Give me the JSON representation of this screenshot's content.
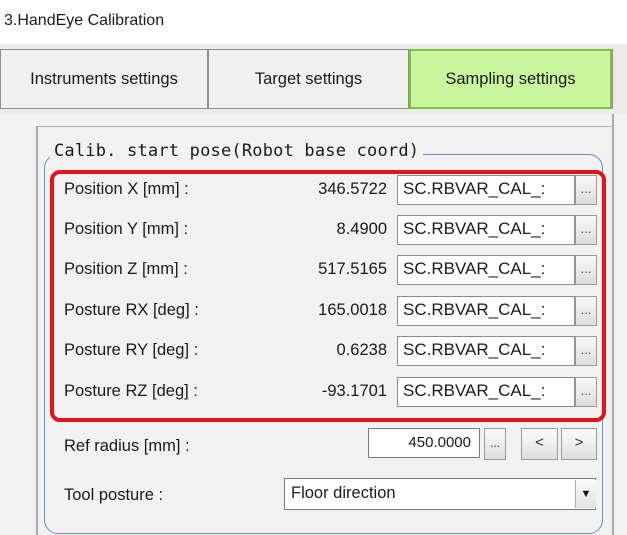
{
  "window": {
    "title": "3.HandEye Calibration"
  },
  "tabs": [
    {
      "label": "Instruments settings"
    },
    {
      "label": "Target settings"
    },
    {
      "label": "Sampling settings",
      "active": true
    }
  ],
  "group": {
    "title": "Calib. start pose(Robot base coord)"
  },
  "pose_rows": [
    {
      "label": "Position X [mm] :",
      "value": "346.5722",
      "variable": "SC.RBVAR_CAL_:",
      "button": "..."
    },
    {
      "label": "Position Y [mm] :",
      "value": "8.4900",
      "variable": "SC.RBVAR_CAL_:",
      "button": "..."
    },
    {
      "label": "Position Z [mm] :",
      "value": "517.5165",
      "variable": "SC.RBVAR_CAL_:",
      "button": "..."
    },
    {
      "label": "Posture RX [deg] :",
      "value": "165.0018",
      "variable": "SC.RBVAR_CAL_:",
      "button": "..."
    },
    {
      "label": "Posture RY [deg] :",
      "value": "0.6238",
      "variable": "SC.RBVAR_CAL_:",
      "button": "..."
    },
    {
      "label": "Posture RZ [deg] :",
      "value": "-93.1701",
      "variable": "SC.RBVAR_CAL_:",
      "button": "..."
    }
  ],
  "ref_radius": {
    "label": "Ref radius [mm] :",
    "value": "450.0000",
    "browse": "...",
    "prev": "<",
    "next": ">"
  },
  "tool_posture": {
    "label": "Tool posture :",
    "selected": "Floor direction",
    "arrow_icon": "dropdown-arrow-icon"
  },
  "colors": {
    "active_tab": "#c9f59c",
    "highlight": "#e0151b",
    "group_border": "#6c8bc9"
  }
}
